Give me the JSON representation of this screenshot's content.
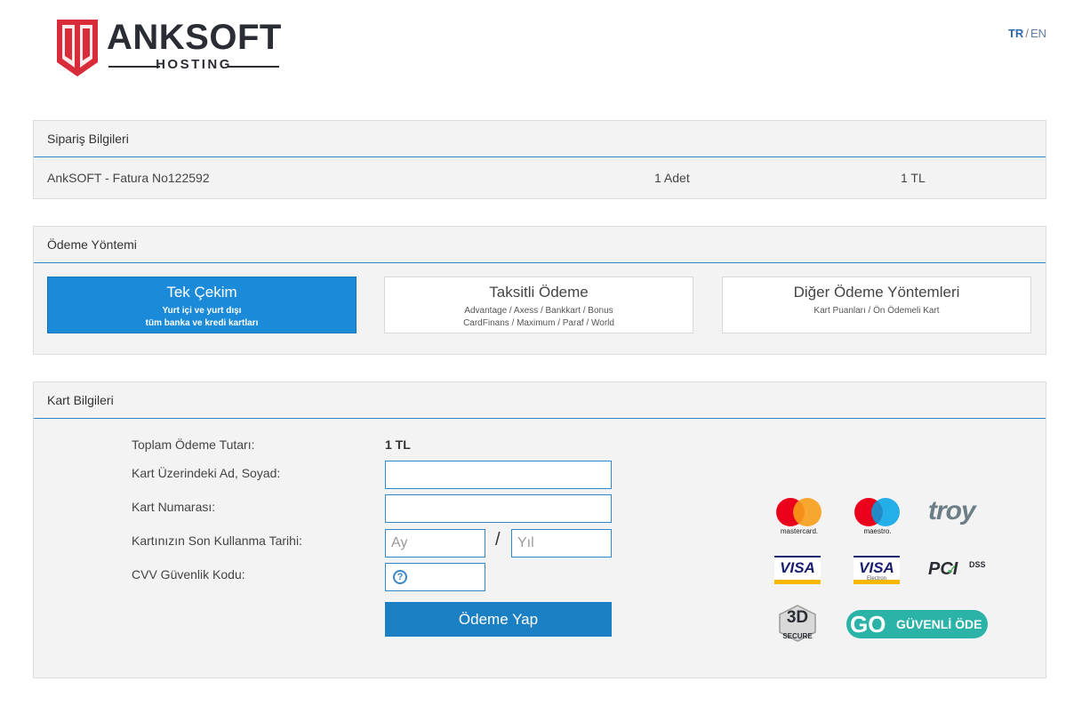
{
  "header": {
    "logo_title": "ANKSOFT",
    "logo_subtitle": "HOSTING",
    "lang_tr": "TR",
    "lang_separator": "/",
    "lang_en": "EN"
  },
  "order": {
    "title": "Sipariş Bilgileri",
    "item_name": "AnkSOFT - Fatura No122592",
    "quantity": "1 Adet",
    "price": "1 TL"
  },
  "payment_method": {
    "title": "Ödeme Yöntemi",
    "options": [
      {
        "title": "Tek Çekim",
        "line1": "Yurt içi ve yurt dışı",
        "line2": "tüm banka ve kredi kartları",
        "active": true
      },
      {
        "title": "Taksitli Ödeme",
        "line1": "Advantage / Axess / Bankkart / Bonus",
        "line2": "CardFinans / Maximum / Paraf / World",
        "active": false
      },
      {
        "title": "Diğer Ödeme Yöntemleri",
        "line1": "Kart Puanları / Ön Ödemeli Kart",
        "line2": "",
        "active": false
      }
    ]
  },
  "card": {
    "title": "Kart Bilgileri",
    "total_label": "Toplam Ödeme Tutarı:",
    "total_value": "1 TL",
    "name_label": "Kart Üzerindeki Ad, Soyad:",
    "name_value": "",
    "number_label": "Kart Numarası:",
    "number_value": "",
    "expiry_label": "Kartınızın Son Kullanma Tarihi:",
    "month_placeholder": "Ay",
    "year_placeholder": "Yıl",
    "expiry_separator": "/",
    "cvv_label": "CVV Güvenlik Kodu:",
    "cvv_help": "?",
    "pay_button": "Ödeme Yap"
  },
  "badges": {
    "mastercard": "mastercard.",
    "maestro": "maestro.",
    "troy": "troy",
    "visa": "VISA",
    "visa_electron_sub": "Electron",
    "pci": "PCI",
    "pci_dss": "DSS",
    "secure_3d_top": "3D",
    "secure_3d_bottom": "SECURE",
    "go": "GO",
    "guvenli_ode": "GÜVENLİ ÖDE"
  },
  "colors": {
    "accent": "#1b8ad9",
    "button": "#1b7fc4",
    "logo_red": "#d82c3a"
  }
}
